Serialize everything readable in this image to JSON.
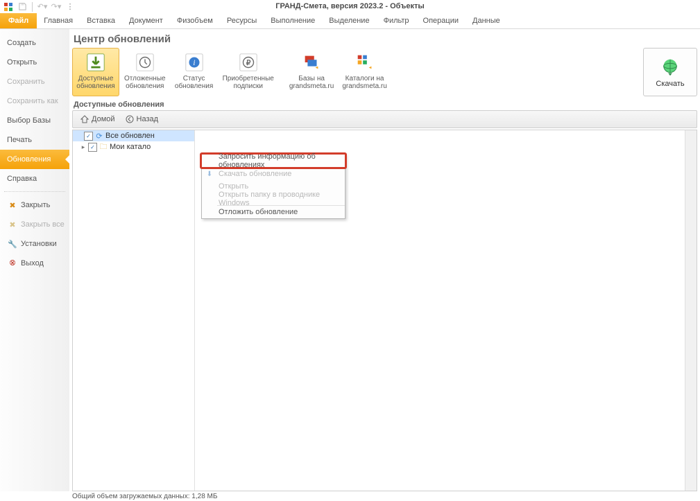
{
  "window_title": "ГРАНД-Смета, версия 2023.2 - Объекты",
  "qat": {
    "undo_tip": "undo",
    "redo_tip": "redo"
  },
  "ribbon_tabs": {
    "file": "Файл",
    "tabs": [
      "Главная",
      "Вставка",
      "Документ",
      "Физобъем",
      "Ресурсы",
      "Выполнение",
      "Выделение",
      "Фильтр",
      "Операции",
      "Данные"
    ]
  },
  "sidebar": {
    "items": [
      {
        "label": "Создать"
      },
      {
        "label": "Открыть"
      },
      {
        "label": "Сохранить",
        "disabled": true
      },
      {
        "label": "Сохранить как",
        "disabled": true
      },
      {
        "label": "Выбор Базы"
      },
      {
        "label": "Печать"
      },
      {
        "label": "Обновления",
        "active": true
      },
      {
        "label": "Справка"
      }
    ],
    "footer": [
      {
        "label": "Закрыть",
        "icon": "close",
        "disabled": false
      },
      {
        "label": "Закрыть все",
        "icon": "close",
        "disabled": true
      },
      {
        "label": "Установки",
        "icon": "install"
      },
      {
        "label": "Выход",
        "icon": "exit"
      }
    ]
  },
  "page": {
    "title": "Центр обновлений",
    "buttons": [
      {
        "l1": "Доступные",
        "l2": "обновления",
        "icon": "download",
        "active": true
      },
      {
        "l1": "Отложенные",
        "l2": "обновления",
        "icon": "clock"
      },
      {
        "l1": "Статус",
        "l2": "обновления",
        "icon": "info"
      },
      {
        "l1": "Приобретенные",
        "l2": "подписки",
        "icon": "ruble"
      },
      {
        "l1": "Базы на",
        "l2": "grandsmeta.ru",
        "icon": "web1"
      },
      {
        "l1": "Каталоги на",
        "l2": "grandsmeta.ru",
        "icon": "web2"
      }
    ],
    "download_label": "Скачать",
    "subheader": "Доступные обновления",
    "breadcrumb": {
      "home": "Домой",
      "back": "Назад"
    },
    "tree": {
      "root": "Все обновлен",
      "child": "Мои катало"
    },
    "context_menu": {
      "m0": "Запросить информацию об обновлениях",
      "m1": "Скачать обновление",
      "m2": "Открыть",
      "m3": "Открыть папку в проводнике Windows",
      "m4": "Отложить обновление"
    },
    "status": "Общий объем загружаемых данных: 1,28 МБ"
  }
}
